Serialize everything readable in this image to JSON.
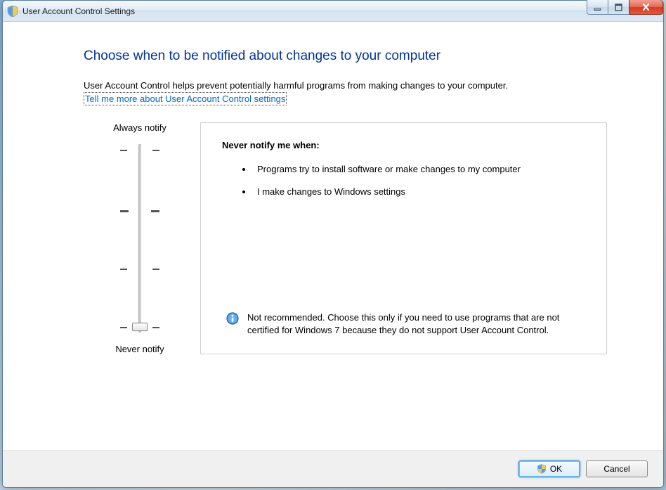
{
  "title": "User Account Control Settings",
  "heading": "Choose when to be notified about changes to your computer",
  "description": "User Account Control helps prevent potentially harmful programs from making changes to your computer.",
  "help_link": "Tell me more about User Account Control settings",
  "slider": {
    "top_label": "Always notify",
    "bottom_label": "Never notify",
    "levels": 4,
    "current_level": 0
  },
  "info": {
    "title": "Never notify me when:",
    "bullets": [
      "Programs try to install software or make changes to my computer",
      "I make changes to Windows settings"
    ],
    "note": "Not recommended. Choose this only if you need to use programs that are not certified for Windows 7 because they do not support User Account Control."
  },
  "buttons": {
    "ok": "OK",
    "cancel": "Cancel"
  },
  "window_controls": {
    "minimize": "Minimize",
    "maximize": "Maximize",
    "close": "Close"
  }
}
